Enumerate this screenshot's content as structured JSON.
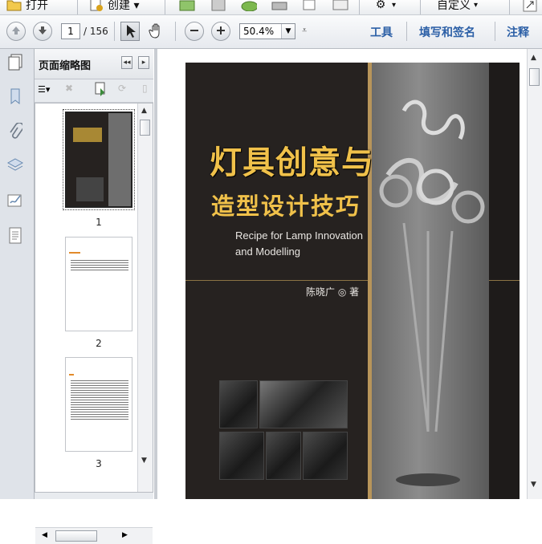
{
  "toolbar": {
    "open_label": "打开",
    "create_label": "创建 ▾",
    "customize_label": "自定义"
  },
  "navigation": {
    "current_page": "1",
    "total_pages": "/ 156",
    "zoom": "50.4%"
  },
  "right_links": {
    "tools": "工具",
    "fill_sign": "填写和签名",
    "comment": "注释"
  },
  "thumbnails_panel": {
    "title": "页面缩略图",
    "pages": [
      {
        "label": "1"
      },
      {
        "label": "2"
      },
      {
        "label": "3"
      }
    ]
  },
  "cover": {
    "title_line1": "灯具创意与",
    "title_line2": "造型设计技巧",
    "subtitle_line1": "Recipe for Lamp Innovation",
    "subtitle_line2": "and Modelling",
    "author": "陈晓广 ◎ 著"
  },
  "colors": {
    "accent_link": "#2b5fa6",
    "cover_bg": "#262220",
    "cover_gold": "#f0c14a"
  }
}
